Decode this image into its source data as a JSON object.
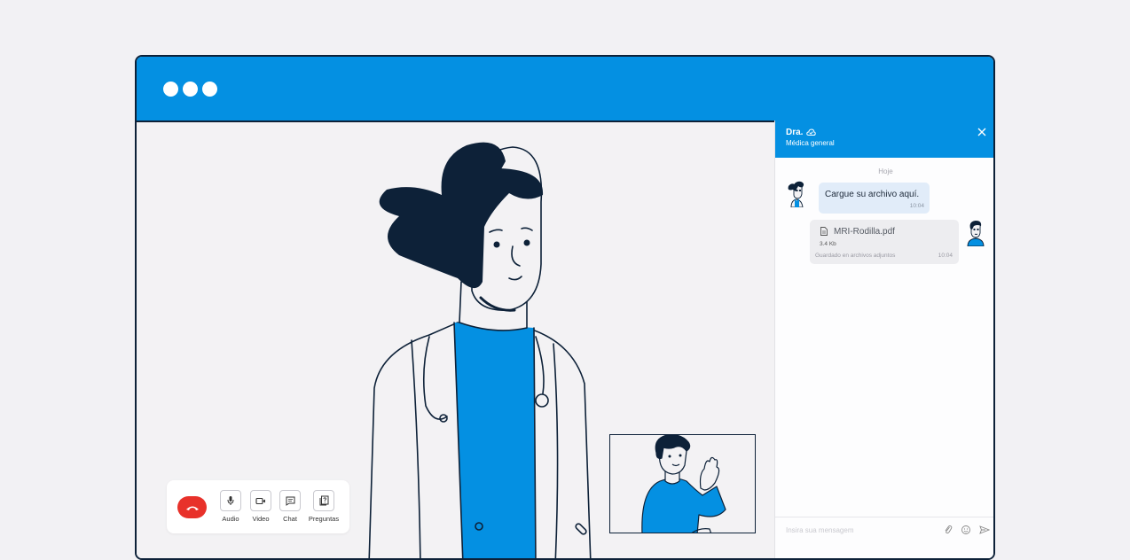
{
  "window": {
    "colors": {
      "titlebar": "#0490e2",
      "outline": "#0d2138",
      "hangup": "#e8312a"
    }
  },
  "controls": {
    "audio_label": "Audio",
    "video_label": "Video",
    "chat_label": "Chat",
    "questions_label": "Preguntas"
  },
  "chat": {
    "doctor_name": "Dra.",
    "doctor_role": "Médica general",
    "date_separator": "Hoje",
    "messages": [
      {
        "text": "Cargue su archivo aquí.",
        "time": "10:04"
      },
      {
        "file_name": "MRI-Rodilla.pdf",
        "file_size": "3.4 Kb",
        "note": "Guardado en archivos adjuntos",
        "time": "10:04"
      }
    ],
    "input_placeholder": "Insira sua mensagem"
  }
}
